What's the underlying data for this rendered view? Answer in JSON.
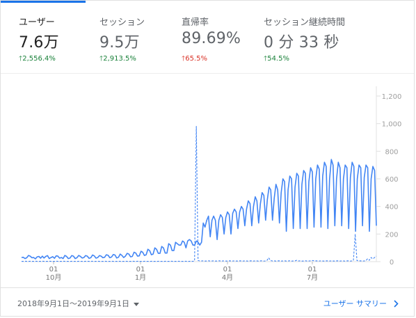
{
  "metrics": [
    {
      "label": "ユーザー",
      "value": "7.6万",
      "delta": "2,556.4%",
      "trend": "up"
    },
    {
      "label": "セッション",
      "value": "9.5万",
      "delta": "2,913.5%",
      "trend": "up"
    },
    {
      "label": "直帰率",
      "value": "89.69%",
      "delta": "65.5%",
      "trend": "down"
    },
    {
      "label": "セッション継続時間",
      "value": "0 分 33 秒",
      "delta": "54.5%",
      "trend": "up"
    }
  ],
  "colors": {
    "accent": "#1a73e8",
    "series": "#4285f4",
    "up": "#188038",
    "down": "#d93025"
  },
  "footer": {
    "date_range": "2018年9月1日～2019年9月1日",
    "summary_link": "ユーザー サマリー"
  },
  "chart_data": {
    "type": "line",
    "x_ticks": [
      {
        "day": "01",
        "month": "10月"
      },
      {
        "day": "01",
        "month": "1月"
      },
      {
        "day": "01",
        "month": "4月"
      },
      {
        "day": "01",
        "month": "7月"
      }
    ],
    "y_ticks": [
      0,
      200,
      400,
      600,
      800,
      1000,
      1200
    ],
    "y_tick_labels": [
      "0",
      "200",
      "400",
      "600",
      "800",
      "1,000",
      "1,200"
    ],
    "ylim": [
      0,
      1200
    ],
    "grid": true,
    "series": [
      {
        "style": "solid",
        "values": [
          30,
          32,
          22,
          28,
          45,
          40,
          28,
          30,
          20,
          35,
          38,
          25,
          40,
          26,
          38,
          44,
          22,
          30,
          36,
          24,
          42,
          40,
          25,
          30,
          22,
          45,
          38,
          22,
          26,
          44,
          40,
          22,
          28,
          45,
          38,
          26,
          30,
          44,
          40,
          24,
          28,
          48,
          42,
          25,
          30,
          44,
          40,
          28,
          32,
          50,
          46,
          28,
          34,
          52,
          48,
          26,
          32,
          55,
          45,
          30,
          40,
          60,
          55,
          35,
          38,
          68,
          62,
          40,
          42,
          75,
          68,
          45,
          50,
          90,
          80,
          50,
          55,
          100,
          90,
          60,
          60,
          110,
          100,
          62,
          62,
          130,
          120,
          80,
          80,
          140,
          130,
          120,
          120,
          150,
          140,
          100,
          150,
          160,
          150,
          120,
          120,
          150,
          140,
          120,
          140,
          280,
          250,
          300,
          330,
          180,
          300,
          330,
          300,
          160,
          300,
          340,
          320,
          200,
          320,
          360,
          340,
          200,
          350,
          380,
          360,
          240,
          360,
          400,
          380,
          260,
          380,
          440,
          420,
          260,
          400,
          470,
          440,
          280,
          420,
          500,
          480,
          300,
          450,
          540,
          520,
          300,
          460,
          560,
          520,
          280,
          500,
          600,
          580,
          220,
          520,
          620,
          600,
          240,
          540,
          640,
          620,
          240,
          560,
          660,
          640,
          240,
          580,
          680,
          650,
          250,
          600,
          700,
          670,
          250,
          620,
          720,
          690,
          240,
          600,
          740,
          700,
          260,
          600,
          720,
          680,
          260,
          600,
          700,
          680,
          240,
          610,
          720,
          690,
          220,
          600,
          700,
          680,
          260,
          610,
          700,
          680,
          220,
          600,
          690,
          660,
          260
        ]
      },
      {
        "style": "dashed",
        "values": [
          2,
          2,
          3,
          2,
          2,
          3,
          2,
          2,
          3,
          2,
          2,
          2,
          3,
          2,
          2,
          2,
          3,
          2,
          2,
          2,
          3,
          2,
          2,
          2,
          3,
          2,
          2,
          2,
          2,
          3,
          2,
          2,
          2,
          3,
          2,
          2,
          2,
          3,
          2,
          2,
          3,
          2,
          2,
          3,
          2,
          2,
          2,
          3,
          2,
          2,
          2,
          3,
          2,
          2,
          2,
          3,
          2,
          2,
          2,
          3,
          2,
          2,
          2,
          3,
          2,
          2,
          3,
          2,
          2,
          2,
          3,
          2,
          2,
          2,
          3,
          2,
          2,
          2,
          3,
          2,
          2,
          2,
          3,
          2,
          2,
          3,
          2,
          2,
          2,
          3,
          2,
          2,
          2,
          3,
          2,
          2,
          3,
          2,
          5,
          980,
          8,
          5,
          5,
          6,
          4,
          5,
          6,
          4,
          5,
          6,
          4,
          5,
          6,
          4,
          5,
          6,
          4,
          5,
          6,
          4,
          5,
          6,
          4,
          5,
          6,
          4,
          5,
          6,
          4,
          5,
          6,
          4,
          5,
          6,
          4,
          5,
          6,
          4,
          5,
          8,
          28,
          8,
          5,
          6,
          4,
          5,
          6,
          4,
          5,
          6,
          4,
          5,
          6,
          4,
          5,
          6,
          10,
          5,
          6,
          4,
          5,
          6,
          4,
          5,
          6,
          8,
          5,
          6,
          4,
          5,
          6,
          4,
          5,
          6,
          4,
          5,
          6,
          4,
          5,
          6,
          4,
          5,
          6,
          4,
          5,
          6,
          4,
          5,
          8,
          200,
          8,
          5,
          6,
          4,
          5,
          6,
          20,
          10,
          30,
          20,
          30,
          40
        ]
      }
    ]
  }
}
